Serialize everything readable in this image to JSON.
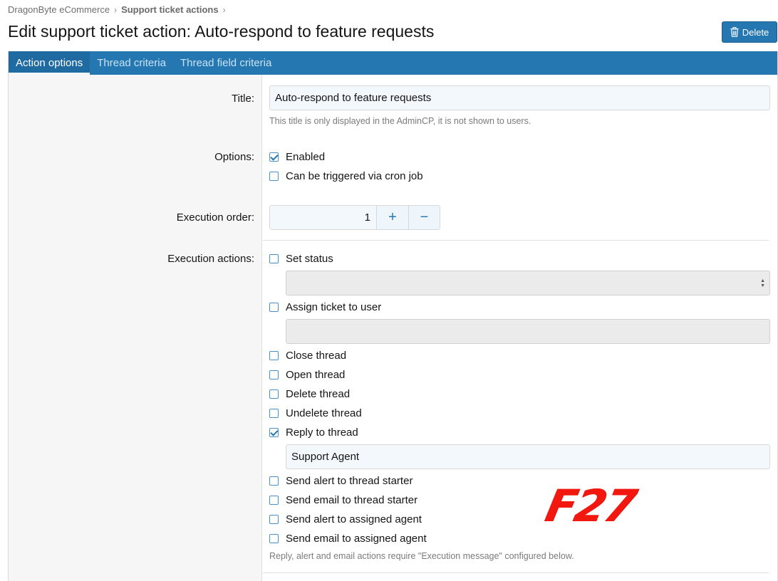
{
  "breadcrumb": [
    {
      "label": "DragonByte eCommerce"
    },
    {
      "label": "Support ticket actions"
    }
  ],
  "page_title": "Edit support ticket action: Auto-respond to feature requests",
  "delete_label": "Delete",
  "tabs": [
    {
      "label": "Action options",
      "active": true
    },
    {
      "label": "Thread criteria",
      "active": false
    },
    {
      "label": "Thread field criteria",
      "active": false
    }
  ],
  "form": {
    "title": {
      "label": "Title:",
      "value": "Auto-respond to feature requests",
      "hint": "This title is only displayed in the AdminCP, it is not shown to users."
    },
    "options": {
      "label": "Options:",
      "items": [
        {
          "label": "Enabled",
          "checked": true
        },
        {
          "label": "Can be triggered via cron job",
          "checked": false
        }
      ]
    },
    "execution_order": {
      "label": "Execution order:",
      "value": "1",
      "plus": "+",
      "minus": "−"
    },
    "execution_actions": {
      "label": "Execution actions:",
      "set_status": {
        "label": "Set status",
        "checked": false
      },
      "assign_ticket": {
        "label": "Assign ticket to user",
        "checked": false
      },
      "close_thread": {
        "label": "Close thread",
        "checked": false
      },
      "open_thread": {
        "label": "Open thread",
        "checked": false
      },
      "delete_thread": {
        "label": "Delete thread",
        "checked": false
      },
      "undelete_thread": {
        "label": "Undelete thread",
        "checked": false
      },
      "reply_thread": {
        "label": "Reply to thread",
        "checked": true,
        "value": "Support Agent"
      },
      "alert_starter": {
        "label": "Send alert to thread starter",
        "checked": false
      },
      "email_starter": {
        "label": "Send email to thread starter",
        "checked": false
      },
      "alert_agent": {
        "label": "Send alert to assigned agent",
        "checked": false
      },
      "email_agent": {
        "label": "Send email to assigned agent",
        "checked": false
      },
      "hint": "Reply, alert and email actions require \"Execution message\" configured below."
    }
  },
  "watermark": "F27",
  "colors": {
    "accent": "#2577b1",
    "watermark": "#f2170f"
  }
}
